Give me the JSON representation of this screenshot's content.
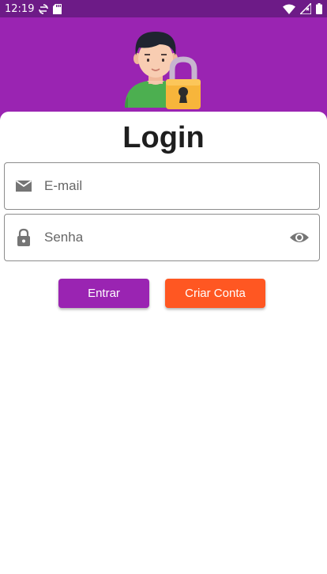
{
  "status_bar": {
    "time": "12:19",
    "icons": [
      "sync-icon",
      "sd-card-icon",
      "wifi-icon",
      "signal-icon",
      "battery-icon"
    ]
  },
  "header": {
    "background_color": "#9a24b2",
    "illustration": "user-with-lock-icon"
  },
  "login": {
    "title": "Login",
    "email": {
      "placeholder": "E-mail",
      "value": "",
      "icon": "email-icon"
    },
    "password": {
      "placeholder": "Senha",
      "value": "",
      "icon": "lock-icon",
      "toggle_icon": "eye-icon"
    },
    "enter_label": "Entrar",
    "create_label": "Criar Conta"
  },
  "colors": {
    "primary": "#9a24b2",
    "status_bar": "#6d1b87",
    "accent": "#ff5722"
  }
}
